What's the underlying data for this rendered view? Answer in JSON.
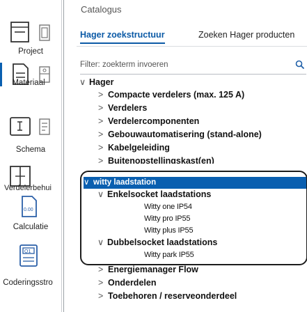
{
  "rail": {
    "items": [
      {
        "label": "Project",
        "icon": "project-panel-icon"
      },
      {
        "label": "Materiaal",
        "icon": "material-document-icon"
      },
      {
        "label": "Schema",
        "icon": "schema-icon"
      },
      {
        "label": "Verdelerbehui",
        "icon": "distribution-box-icon"
      },
      {
        "label": "Calculatie",
        "icon": "calculation-icon"
      },
      {
        "label": "Coderingsstro",
        "icon": "coding-icon"
      }
    ]
  },
  "header": {
    "title": "Catalogus"
  },
  "tabs": [
    {
      "label": "Hager zoekstructuur",
      "active": true
    },
    {
      "label": "Zoeken Hager producten",
      "active": false
    }
  ],
  "filter": {
    "placeholder": "Filter: zoekterm invoeren"
  },
  "tree": {
    "root": {
      "chevron": "∨",
      "label": "Hager"
    },
    "groups": [
      {
        "chevron": ">",
        "label": "Compacte verdelers (max. 125 A)"
      },
      {
        "chevron": ">",
        "label": "Verdelers"
      },
      {
        "chevron": ">",
        "label": "Verdelercomponenten"
      },
      {
        "chevron": ">",
        "label": "Gebouwautomatisering (stand-alone)"
      },
      {
        "chevron": ">",
        "label": "Kabelgeleiding"
      },
      {
        "chevron": ">",
        "label": "Buitenopstellingskast(en)"
      }
    ],
    "selected": {
      "chevron": "∨",
      "label": "witty laadstation"
    },
    "enkelsocket": {
      "chevron": "∨",
      "label": "Enkelsocket laadstations"
    },
    "enkel_items": [
      "Witty one IP54",
      "Witty pro IP55",
      "Witty plus IP55"
    ],
    "dubbelsocket": {
      "chevron": "∨",
      "label": "Dubbelsocket laadstations"
    },
    "dubbel_items": [
      "Witty park IP55"
    ],
    "after": [
      {
        "chevron": ">",
        "label": "Energiemanager Flow"
      },
      {
        "chevron": ">",
        "label": "Onderdelen"
      },
      {
        "chevron": ">",
        "label": "Toebehoren / reserveonderdeel"
      }
    ]
  },
  "colors": {
    "accent": "#0a5fb0",
    "selection": "#0a5fb0",
    "text": "#111111"
  }
}
